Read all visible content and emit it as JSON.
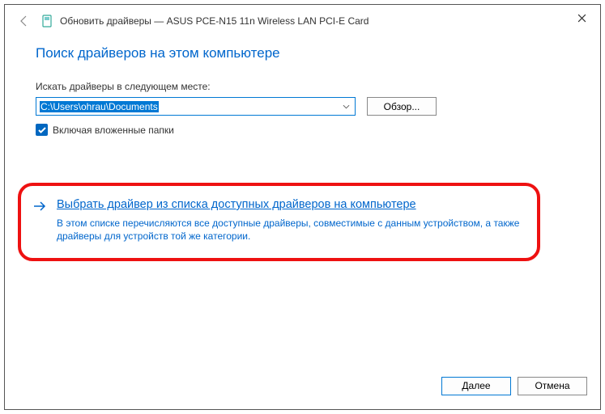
{
  "titlebar": {
    "title": "Обновить драйверы — ASUS PCE-N15 11n Wireless LAN PCI-E Card"
  },
  "content": {
    "heading": "Поиск драйверов на этом компьютере",
    "path_label": "Искать драйверы в следующем месте:",
    "path_value": "C:\\Users\\ohrau\\Documents",
    "browse_label": "Обзор...",
    "include_subfolders_label": "Включая вложенные папки"
  },
  "option": {
    "title": "Выбрать драйвер из списка доступных драйверов на компьютере",
    "description": "В этом списке перечисляются все доступные драйверы, совместимые с данным устройством, а также драйверы для устройств той же категории."
  },
  "footer": {
    "next": "Далее",
    "cancel": "Отмена"
  }
}
